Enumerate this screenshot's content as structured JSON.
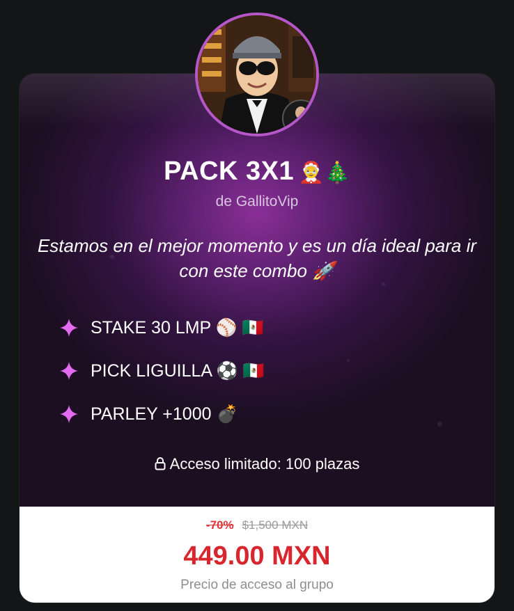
{
  "pack": {
    "title": "PACK 3X1",
    "title_emoji": "🤶🎄",
    "byline": "de GallitoVip",
    "description": "Estamos en el mejor momento y es un día ideal para ir con este combo 🚀"
  },
  "features": [
    {
      "label": "STAKE 30 LMP ⚾ 🇲🇽",
      "icon": "sparkle-icon"
    },
    {
      "label": "PICK LIGUILLA ⚽ 🇲🇽",
      "icon": "sparkle-icon"
    },
    {
      "label": "PARLEY +1000 💣",
      "icon": "sparkle-icon"
    }
  ],
  "access": {
    "icon": "lock-icon",
    "text": "Acceso limitado: 100 plazas"
  },
  "pricing": {
    "discount": "-70%",
    "original_price": "$1,500 MXN",
    "price": "449.00 MXN",
    "caption": "Precio de acceso al grupo"
  },
  "colors": {
    "accent_purple": "#b657c9",
    "price_red": "#d8262e",
    "sparkle_pink": "#e36bf0",
    "background": "#131517"
  }
}
